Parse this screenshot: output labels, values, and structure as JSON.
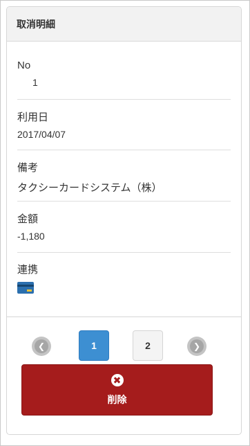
{
  "panel": {
    "title": "取消明細"
  },
  "fields": {
    "no": {
      "label": "No",
      "value": "1"
    },
    "date": {
      "label": "利用日",
      "value": "2017/04/07"
    },
    "note": {
      "label": "備考",
      "value": "タクシーカードシステム（株）"
    },
    "amount": {
      "label": "金額",
      "value": "-1,180"
    },
    "link": {
      "label": "連携",
      "icon": "credit-card-icon"
    }
  },
  "pagination": {
    "prev_icon": "chevron-left-icon",
    "next_icon": "chevron-right-icon",
    "pages": [
      "1",
      "2"
    ],
    "current": "1"
  },
  "delete_button": {
    "label": "削除",
    "icon": "close-icon"
  },
  "colors": {
    "active_page": "#3d8fd2",
    "delete": "#a51c1c",
    "card": "#2b6fae"
  }
}
